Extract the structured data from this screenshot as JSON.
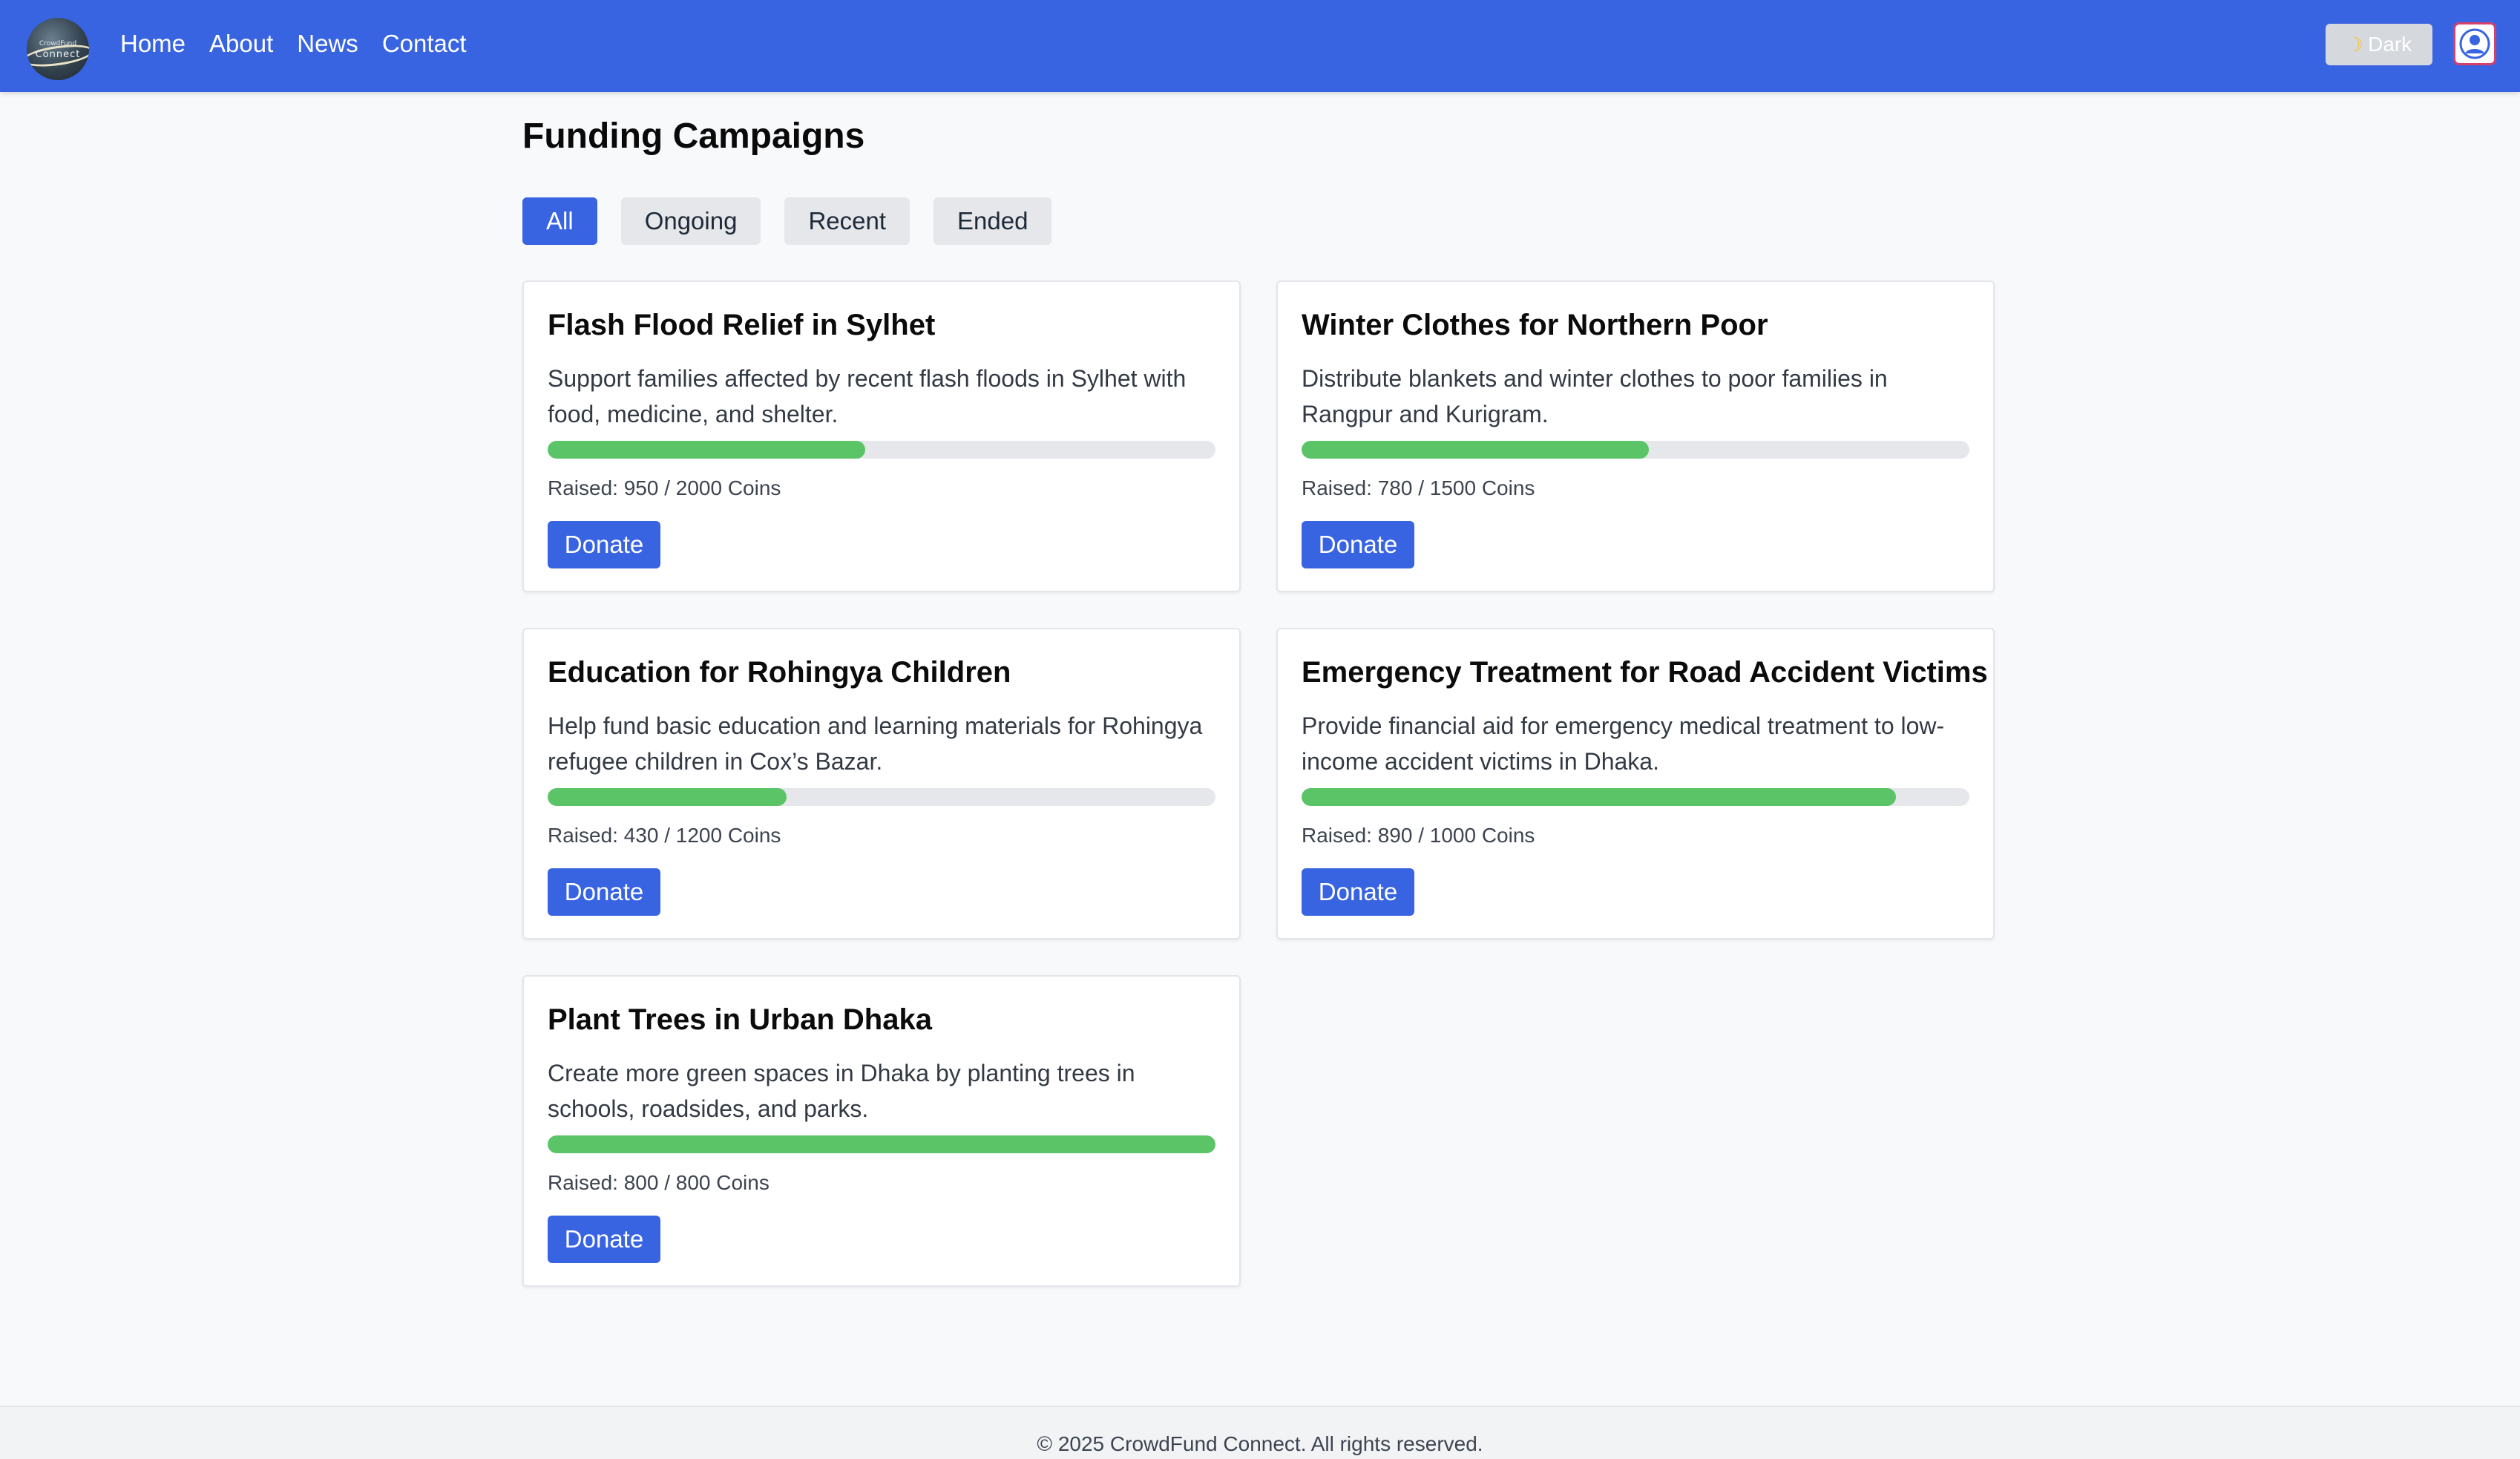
{
  "navbar": {
    "logo_text_small": "CrowdFund",
    "logo_text_large": "Connect",
    "links": [
      "Home",
      "About",
      "News",
      "Contact"
    ],
    "theme_toggle_label": "Dark",
    "theme_toggle_icon": "moon-icon",
    "avatar_icon": "user-avatar-icon",
    "brand_color": "#3964e1"
  },
  "main": {
    "title": "Funding Campaigns",
    "filters": [
      {
        "label": "All",
        "active": true
      },
      {
        "label": "Ongoing",
        "active": false
      },
      {
        "label": "Recent",
        "active": false
      },
      {
        "label": "Ended",
        "active": false
      }
    ],
    "campaigns": [
      {
        "title": "Flash Flood Relief in Sylhet",
        "description": "Support families affected by recent flash floods in Sylhet with food, medicine, and shelter.",
        "raised_text": "Raised: 950 / 2000 Coins",
        "raised": 950,
        "goal": 2000,
        "donate_label": "Donate"
      },
      {
        "title": "Winter Clothes for Northern Poor",
        "description": "Distribute blankets and winter clothes to poor families in Rangpur and Kurigram.",
        "raised_text": "Raised: 780 / 1500 Coins",
        "raised": 780,
        "goal": 1500,
        "donate_label": "Donate"
      },
      {
        "title": "Education for Rohingya Children",
        "description": "Help fund basic education and learning materials for Rohingya refugee children in Cox’s Bazar.",
        "raised_text": "Raised: 430 / 1200 Coins",
        "raised": 430,
        "goal": 1200,
        "donate_label": "Donate"
      },
      {
        "title": "Emergency Treatment for Road Accident Victims",
        "description": "Provide financial aid for emergency medical treatment to low-income accident victims in Dhaka.",
        "raised_text": "Raised: 890 / 1000 Coins",
        "raised": 890,
        "goal": 1000,
        "donate_label": "Donate"
      },
      {
        "title": "Plant Trees in Urban Dhaka",
        "description": "Create more green spaces in Dhaka by planting trees in schools, roadsides, and parks.",
        "raised_text": "Raised: 800 / 800 Coins",
        "raised": 800,
        "goal": 800,
        "donate_label": "Donate"
      }
    ],
    "progress_color": "#5bc467"
  },
  "footer": {
    "text": "© 2025 CrowdFund Connect. All rights reserved."
  }
}
